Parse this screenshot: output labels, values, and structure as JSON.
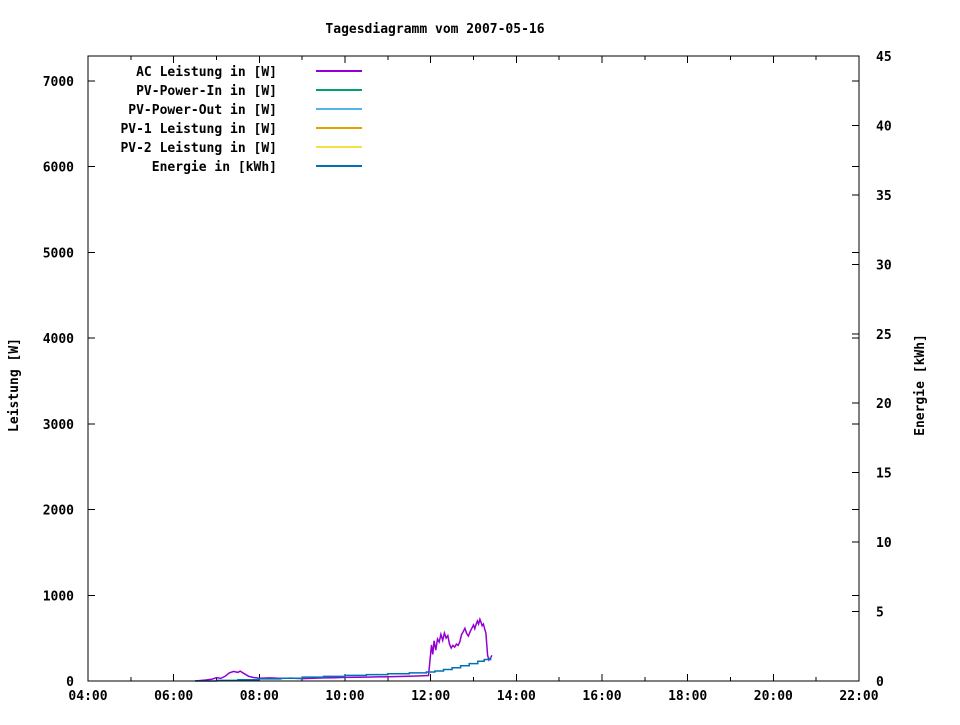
{
  "title": "Tagesdiagramm vom 2007-05-16",
  "chart_data": {
    "type": "line",
    "title": "Tagesdiagramm vom 2007-05-16",
    "grid": false,
    "legend_position": "top-left-inside",
    "x_axis": {
      "label": "",
      "range_hours": [
        4,
        22
      ],
      "major_tick_hours": 2,
      "minor_tick_hours": 1,
      "tick_labels": [
        "04:00",
        "06:00",
        "08:00",
        "10:00",
        "12:00",
        "14:00",
        "16:00",
        "18:00",
        "20:00",
        "22:00"
      ]
    },
    "y_axis_left": {
      "label": "Leistung [W]",
      "range": [
        0,
        7292
      ],
      "ticks": [
        0,
        1000,
        2000,
        3000,
        4000,
        5000,
        6000,
        7000
      ]
    },
    "y_axis_right": {
      "label": "Energie [kWh]",
      "range": [
        0,
        45
      ],
      "ticks": [
        0,
        5,
        10,
        15,
        20,
        25,
        30,
        35,
        40,
        45
      ]
    },
    "legend": [
      {
        "label": "AC Leistung in [W]",
        "color": "#9400D3"
      },
      {
        "label": "PV-Power-In in [W]",
        "color": "#009E73"
      },
      {
        "label": "PV-Power-Out in [W]",
        "color": "#56B4E9"
      },
      {
        "label": "PV-1 Leistung in [W]",
        "color": "#E69F00"
      },
      {
        "label": "PV-2 Leistung in [W]",
        "color": "#F0E442"
      },
      {
        "label": "Energie in [kWh]",
        "color": "#0072B2"
      }
    ],
    "series": [
      {
        "name": "AC Leistung in [W]",
        "axis": "left",
        "color": "#9400D3",
        "step": false,
        "points": [
          [
            6.5,
            0
          ],
          [
            6.6,
            5
          ],
          [
            6.75,
            12
          ],
          [
            6.9,
            22
          ],
          [
            7.0,
            40
          ],
          [
            7.1,
            30
          ],
          [
            7.2,
            55
          ],
          [
            7.3,
            95
          ],
          [
            7.4,
            112
          ],
          [
            7.5,
            100
          ],
          [
            7.55,
            115
          ],
          [
            7.65,
            85
          ],
          [
            7.75,
            55
          ],
          [
            7.85,
            42
          ],
          [
            8.0,
            32
          ],
          [
            8.25,
            36
          ],
          [
            8.5,
            30
          ],
          [
            8.75,
            34
          ],
          [
            9.0,
            28
          ],
          [
            9.25,
            33
          ],
          [
            9.5,
            36
          ],
          [
            9.75,
            38
          ],
          [
            10.0,
            42
          ],
          [
            10.25,
            44
          ],
          [
            10.5,
            46
          ],
          [
            10.75,
            48
          ],
          [
            11.0,
            50
          ],
          [
            11.25,
            53
          ],
          [
            11.5,
            56
          ],
          [
            11.75,
            60
          ],
          [
            11.95,
            64
          ],
          [
            12.02,
            420
          ],
          [
            12.05,
            310
          ],
          [
            12.08,
            470
          ],
          [
            12.12,
            360
          ],
          [
            12.16,
            490
          ],
          [
            12.2,
            455
          ],
          [
            12.24,
            545
          ],
          [
            12.28,
            475
          ],
          [
            12.32,
            560
          ],
          [
            12.36,
            500
          ],
          [
            12.4,
            530
          ],
          [
            12.44,
            430
          ],
          [
            12.48,
            385
          ],
          [
            12.52,
            415
          ],
          [
            12.56,
            395
          ],
          [
            12.6,
            430
          ],
          [
            12.64,
            415
          ],
          [
            12.68,
            455
          ],
          [
            12.72,
            540
          ],
          [
            12.76,
            575
          ],
          [
            12.8,
            615
          ],
          [
            12.84,
            555
          ],
          [
            12.88,
            525
          ],
          [
            12.92,
            575
          ],
          [
            12.96,
            615
          ],
          [
            13.0,
            655
          ],
          [
            13.03,
            610
          ],
          [
            13.06,
            660
          ],
          [
            13.09,
            700
          ],
          [
            13.12,
            665
          ],
          [
            13.15,
            720
          ],
          [
            13.18,
            680
          ],
          [
            13.2,
            645
          ],
          [
            13.23,
            665
          ],
          [
            13.26,
            610
          ],
          [
            13.29,
            560
          ],
          [
            13.31,
            420
          ],
          [
            13.33,
            300
          ],
          [
            13.36,
            245
          ],
          [
            13.4,
            270
          ],
          [
            13.43,
            300
          ]
        ]
      },
      {
        "name": "Energie in [kWh]",
        "axis": "right",
        "color": "#0072B2",
        "step": true,
        "points": [
          [
            6.5,
            0.0
          ],
          [
            7.0,
            0.04
          ],
          [
            7.5,
            0.09
          ],
          [
            8.0,
            0.15
          ],
          [
            8.5,
            0.2
          ],
          [
            9.0,
            0.28
          ],
          [
            9.5,
            0.33
          ],
          [
            10.0,
            0.4
          ],
          [
            10.5,
            0.46
          ],
          [
            11.0,
            0.52
          ],
          [
            11.5,
            0.58
          ],
          [
            11.9,
            0.65
          ],
          [
            12.1,
            0.72
          ],
          [
            12.3,
            0.83
          ],
          [
            12.5,
            0.95
          ],
          [
            12.7,
            1.1
          ],
          [
            12.9,
            1.25
          ],
          [
            13.1,
            1.42
          ],
          [
            13.25,
            1.55
          ],
          [
            13.4,
            1.7
          ]
        ]
      }
    ]
  }
}
